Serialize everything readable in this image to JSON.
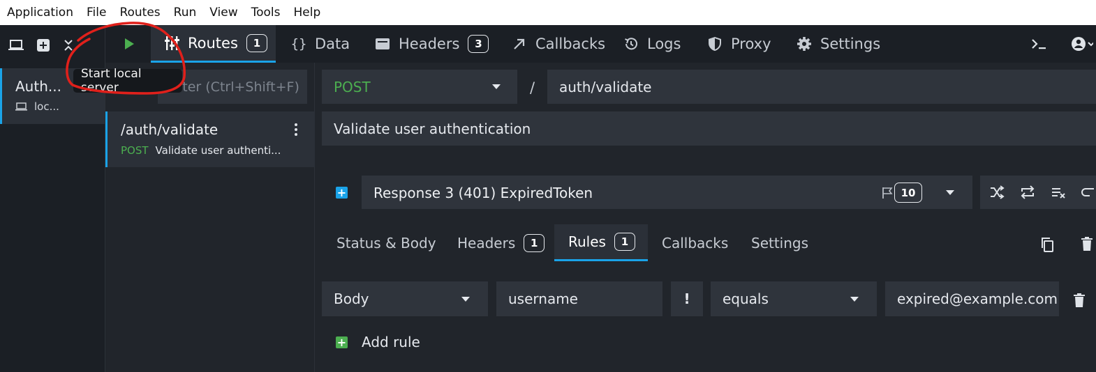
{
  "menu": [
    "Application",
    "File",
    "Routes",
    "Run",
    "View",
    "Tools",
    "Help"
  ],
  "environment": {
    "name": "Auth...",
    "host": "loc..."
  },
  "tooltip": "Start local server",
  "nav": {
    "routes": {
      "label": "Routes",
      "count": "1"
    },
    "data": {
      "label": "Data"
    },
    "headers": {
      "label": "Headers",
      "count": "3"
    },
    "callbacks": {
      "label": "Callbacks"
    },
    "logs": {
      "label": "Logs"
    },
    "proxy": {
      "label": "Proxy"
    },
    "settings": {
      "label": "Settings"
    }
  },
  "routes": {
    "filter_placeholder": "lter (Ctrl+Shift+F)",
    "items": [
      {
        "path": "/auth/validate",
        "method": "POST",
        "description": "Validate user authenti..."
      }
    ]
  },
  "route": {
    "method": "POST",
    "separator": "/",
    "path": "auth/validate",
    "documentation": "Validate user authentication"
  },
  "response": {
    "label": "Response 3 (401)  ExpiredToken",
    "latency": "10"
  },
  "subtabs": {
    "status_body": "Status & Body",
    "headers": {
      "label": "Headers",
      "count": "1"
    },
    "rules": {
      "label": "Rules",
      "count": "1"
    },
    "callbacks": "Callbacks",
    "settings": "Settings"
  },
  "rule": {
    "target": "Body",
    "property": "username",
    "invert": "!",
    "operator": "equals",
    "value": "expired@example.com"
  },
  "add_rule_label": "Add rule",
  "colors": {
    "accent": "#1aa3e8",
    "method_green": "#4caf50",
    "annotation_red": "#e0201b",
    "panel": "#21252b",
    "field": "#2f343c"
  }
}
